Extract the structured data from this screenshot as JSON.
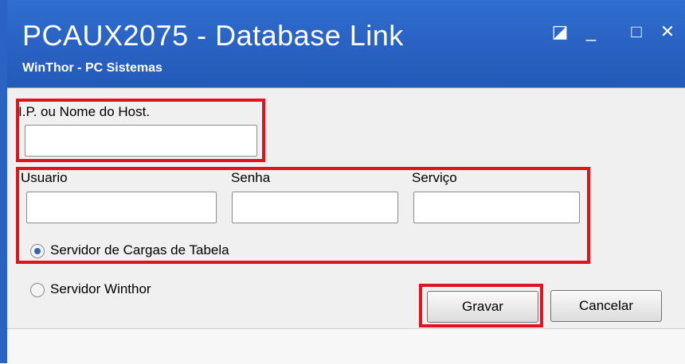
{
  "window": {
    "title": "PCAUX2075 - Database Link",
    "subtitle": "WinThor - PC Sistemas",
    "controls": {
      "restore": "◪",
      "minimize": "_",
      "maximize": "□",
      "close": "✕"
    }
  },
  "form": {
    "host_label": "I.P. ou Nome do Host.",
    "host_value": "",
    "user_label": "Usuario",
    "user_value": "",
    "password_label": "Senha",
    "password_value": "",
    "service_label": "Serviço",
    "service_value": "",
    "radio_table_server": "Servidor de Cargas de Tabela",
    "radio_winthor_server": "Servidor Winthor",
    "selected_radio": "radio_table_server"
  },
  "buttons": {
    "save": "Gravar",
    "cancel": "Cancelar"
  },
  "colors": {
    "highlight": "#e0141e",
    "titlebar": "#2a63c4"
  }
}
